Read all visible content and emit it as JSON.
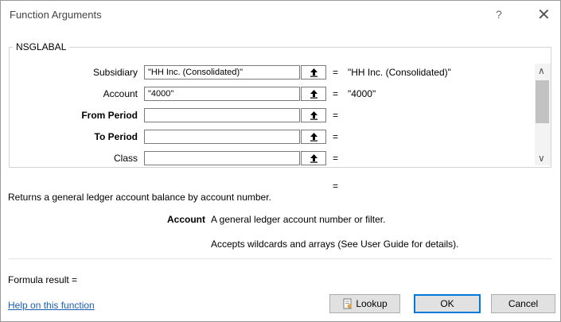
{
  "dialog": {
    "title": "Function Arguments",
    "help_glyph": "?",
    "close_glyph": "✕"
  },
  "group": {
    "title": "NSGLABAL"
  },
  "args": [
    {
      "label": "Subsidiary",
      "value": "\"HH Inc. (Consolidated)\"",
      "eq": "=",
      "result": "\"HH Inc. (Consolidated)\""
    },
    {
      "label": "Account",
      "value": "\"4000\"",
      "eq": "=",
      "result": "\"4000\""
    },
    {
      "label": "From Period",
      "value": "",
      "eq": "=",
      "result": ""
    },
    {
      "label": "To Period",
      "value": "",
      "eq": "=",
      "result": ""
    },
    {
      "label": "Class",
      "value": "",
      "eq": "=",
      "result": ""
    }
  ],
  "scroll": {
    "up": "∧",
    "down": "∨"
  },
  "function_result_eq": "=",
  "description": "Returns a general ledger account balance by account number.",
  "arg_help": {
    "name": "Account",
    "text": "A general ledger account number or filter.",
    "detail": "Accepts wildcards and arrays (See User Guide for details)."
  },
  "formula_result_label": "Formula result =",
  "help_link": "Help on this function",
  "buttons": {
    "lookup": "Lookup",
    "ok": "OK",
    "cancel": "Cancel"
  },
  "icons": {
    "ref_picker": "collapse-arrow-icon",
    "lookup": "lookup-icon"
  }
}
